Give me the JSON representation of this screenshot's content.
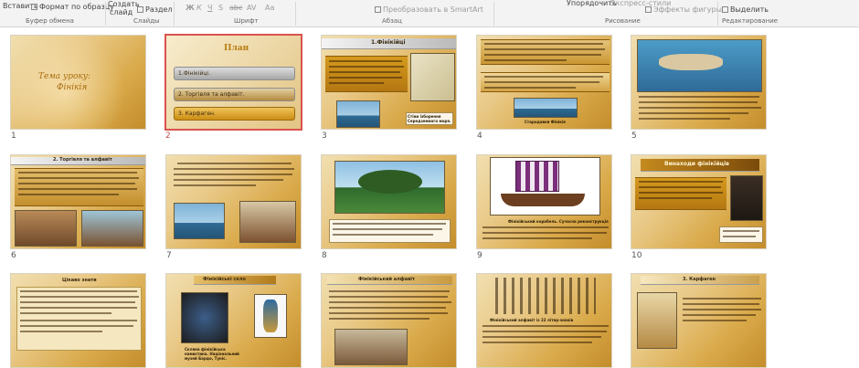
{
  "ribbon": {
    "clipboard": {
      "paste": "Вставить",
      "format_painter": "Формат по образцу",
      "group": "Буфер обмена"
    },
    "slides": {
      "create_line1": "Создать",
      "create_line2": "слайд",
      "section": "Раздел",
      "group": "Слайды"
    },
    "font": {
      "bold": "Ж",
      "italic": "К",
      "underline": "Ч",
      "shadow": "S",
      "strike": "abc",
      "spacing": "AV",
      "case": "Aa",
      "group": "Шрифт"
    },
    "paragraph": {
      "smartart": "Преобразовать в SmartArt",
      "group": "Абзац"
    },
    "drawing": {
      "arrange": "Упорядочить",
      "styles": "Экспресс-стили",
      "effects": "Эффекты фигуры",
      "group": "Рисование"
    },
    "editing": {
      "select": "Выделить",
      "group": "Редактирование"
    }
  },
  "slides": [
    {
      "num": "1",
      "title_line1": "Тема уроку:",
      "title_line2": "Фінікія"
    },
    {
      "num": "2",
      "title": "План",
      "items": [
        "1.Фінікійці.",
        "2. Торгівля та алфавіт.",
        "3. Карфаген."
      ]
    },
    {
      "num": "3",
      "title": "1.Фінікійці",
      "caption": "Стіни ізборення Середземного моря."
    },
    {
      "num": "4",
      "caption": "Стародавня Фінікія"
    },
    {
      "num": "5"
    },
    {
      "num": "6",
      "title": "2. Торгівля та алфавіт"
    },
    {
      "num": "7"
    },
    {
      "num": "8"
    },
    {
      "num": "9",
      "caption": "Фінікійський корабель. Сучасна реконструкція"
    },
    {
      "num": "10",
      "title": "Винаходи фінікійців"
    },
    {
      "num": "11",
      "title": "Цікаво знати"
    },
    {
      "num": "12",
      "title": "Фінікійські скло",
      "caption": "Скляна фінікійська намистина. Національний музей Бардо, Туніс."
    },
    {
      "num": "13",
      "title": "Фінікійський алфавіт"
    },
    {
      "num": "14",
      "caption": "Фінікійський алфавіт із 22 літер-знаків"
    },
    {
      "num": "15",
      "title": "3. Карфаген"
    }
  ]
}
